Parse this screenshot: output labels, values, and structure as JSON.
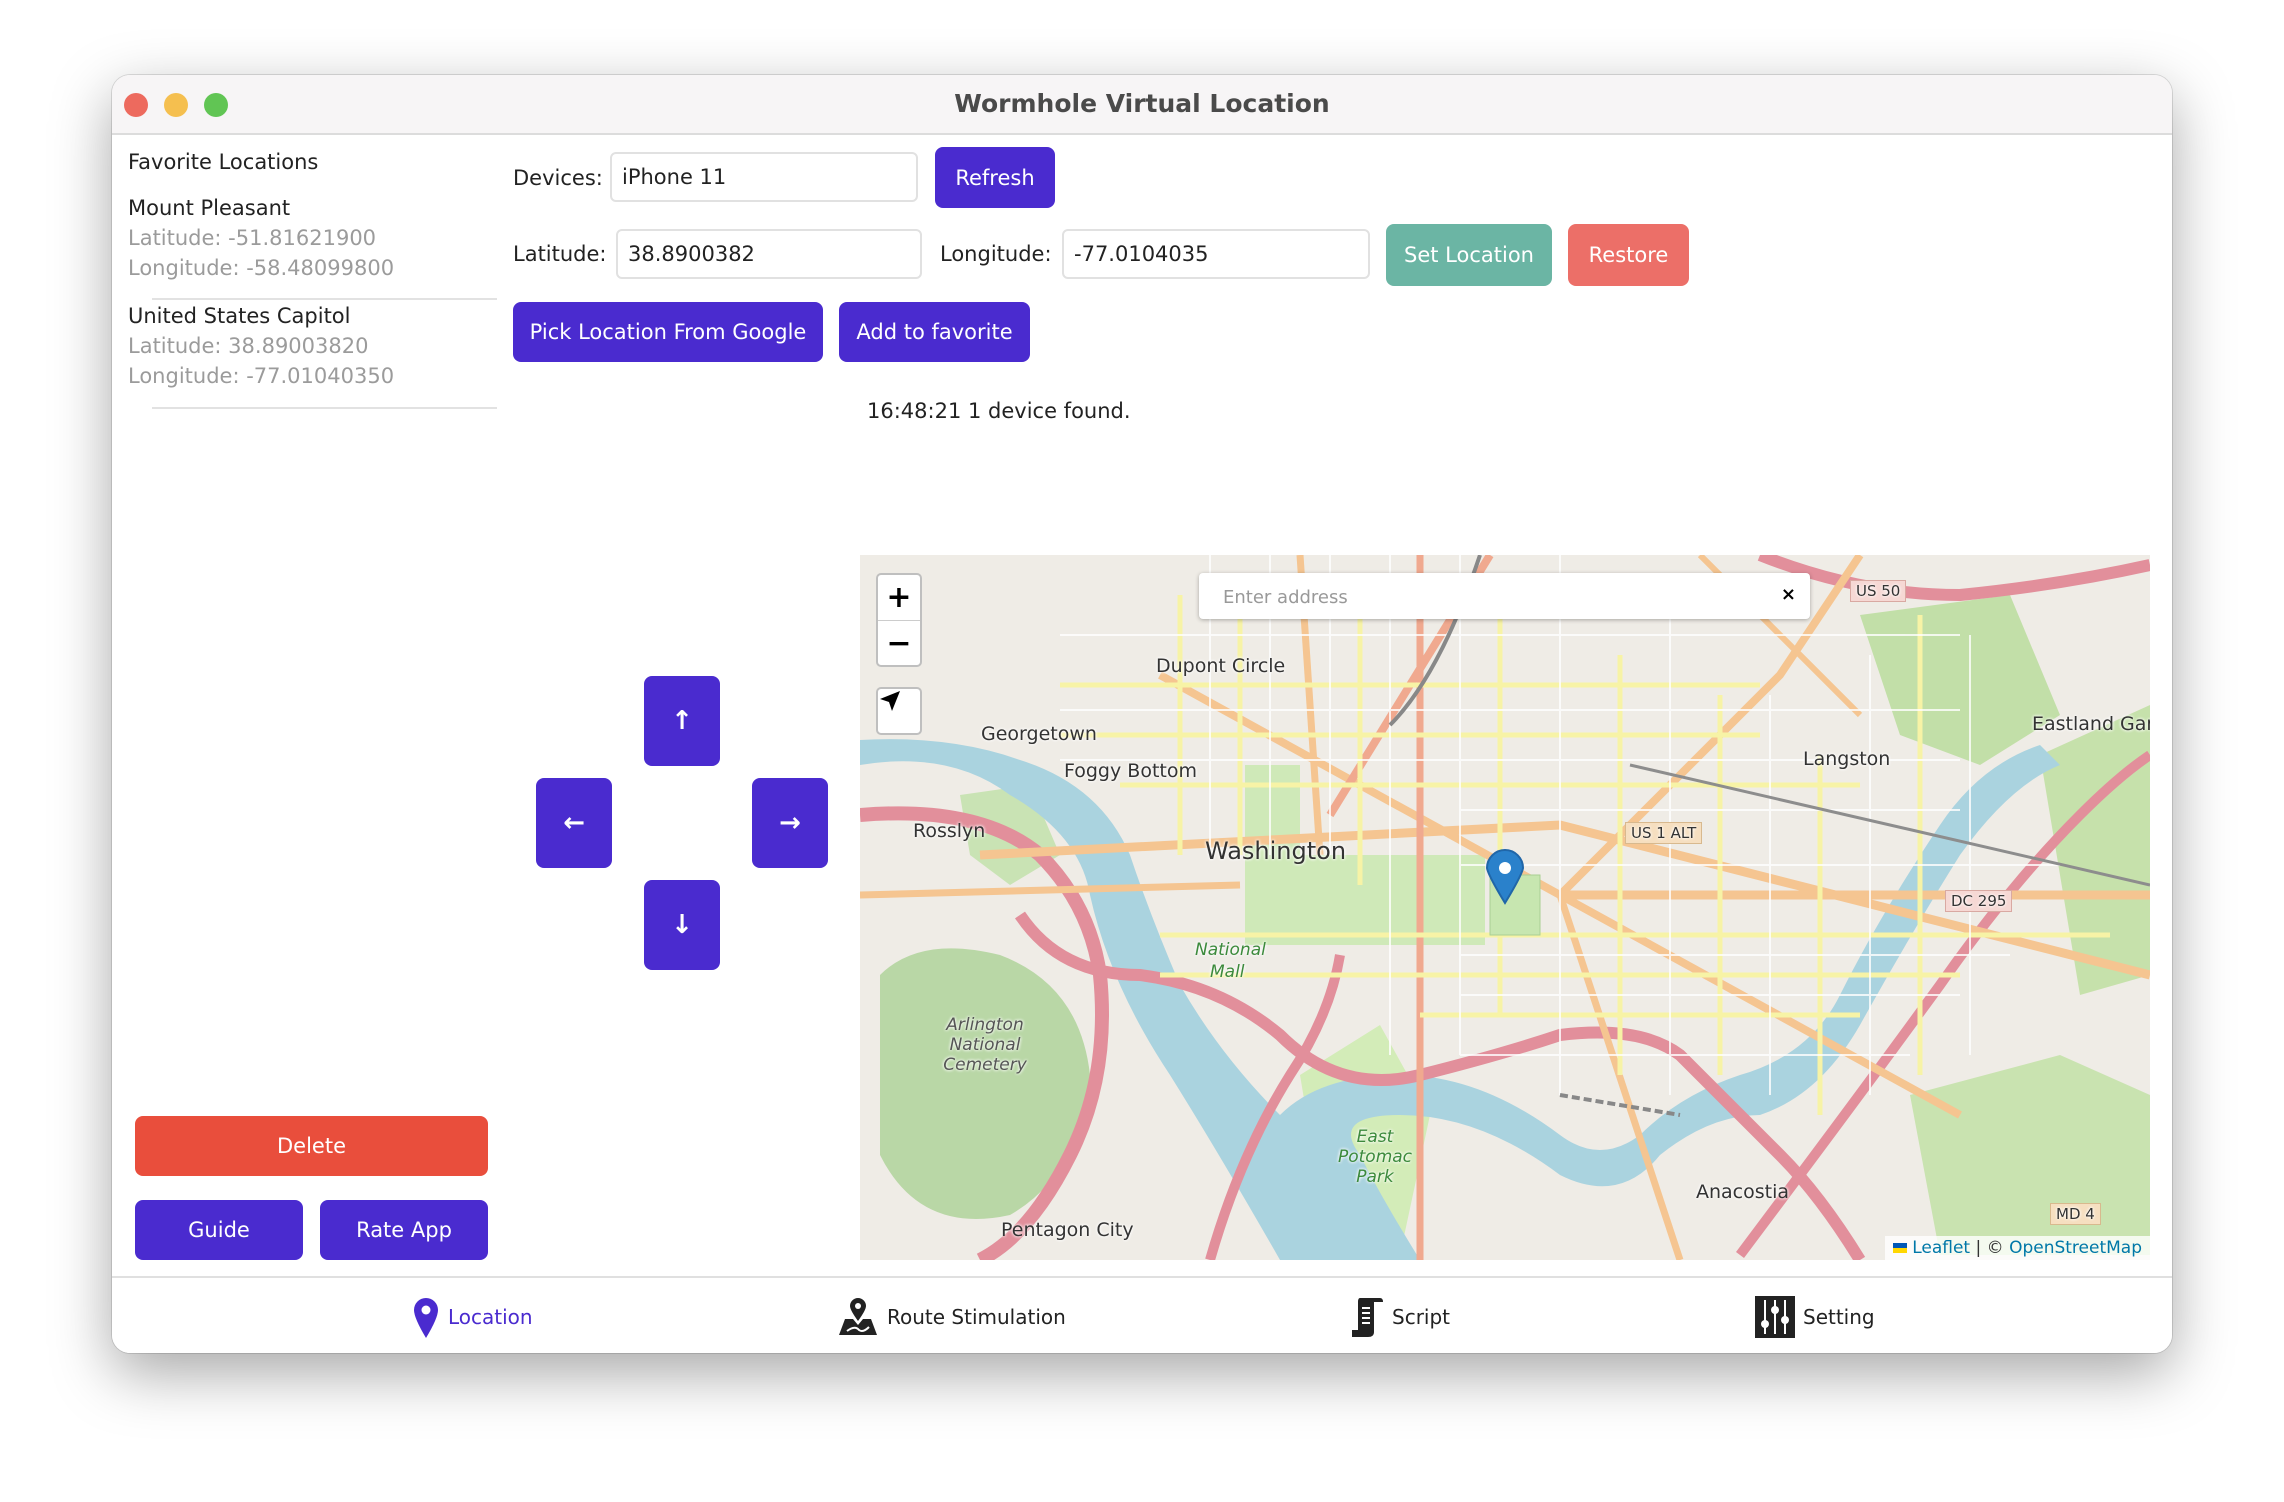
{
  "window": {
    "title": "Wormhole Virtual Location"
  },
  "colors": {
    "primary": "#4a2bcf",
    "delete": "#e94e3c",
    "set_location": "#6bb5a4",
    "restore": "#ec6f68",
    "close": "#ed6a5e",
    "minimize": "#f5bf4f",
    "maximize": "#61c554"
  },
  "sidebar": {
    "heading": "Favorite Locations",
    "favorites": [
      {
        "name": "Mount Pleasant",
        "latitude": "Latitude: -51.81621900",
        "longitude": "Longitude: -58.48099800"
      },
      {
        "name": "United States Capitol",
        "latitude": "Latitude: 38.89003820",
        "longitude": "Longitude: -77.01040350"
      }
    ],
    "delete_label": "Delete",
    "guide_label": "Guide",
    "rate_label": "Rate App"
  },
  "controls": {
    "devices_label": "Devices:",
    "device_value": "iPhone 11",
    "refresh_label": "Refresh",
    "latitude_label": "Latitude:",
    "latitude_value": "38.8900382",
    "longitude_label": "Longitude:",
    "longitude_value": "-77.0104035",
    "set_location_label": "Set Location",
    "restore_label": "Restore",
    "pick_google_label": "Pick Location From Google",
    "add_favorite_label": "Add to favorite",
    "status": "16:48:21 1 device found."
  },
  "dpad": {
    "up": "↑",
    "left": "←",
    "right": "→",
    "down": "↓"
  },
  "map": {
    "zoom_in": "+",
    "zoom_out": "−",
    "search_placeholder": "Enter address",
    "search_clear": "×",
    "attribution_leaflet": "Leaflet",
    "attribution_sep": " | © ",
    "attribution_osm": "OpenStreetMap",
    "labels": {
      "washington": "Washington",
      "dupont": "Dupont Circle",
      "georgetown": "Georgetown",
      "foggy": "Foggy Bottom",
      "rosslyn": "Rosslyn",
      "national_mall_1": "National",
      "national_mall_2": "Mall",
      "langston": "Langston",
      "eastland": "Eastland Garc",
      "anacostia": "Anacostia",
      "pentagon": "Pentagon City",
      "arlington": "Arlington National Cemetery",
      "east_potomac": "East Potomac Park",
      "us50": "US 50",
      "us1alt": "US 1 ALT",
      "dc295": "DC 295",
      "md4": "MD 4"
    }
  },
  "tabs": [
    {
      "label": "Location",
      "icon": "map-pin-icon",
      "active": true
    },
    {
      "label": "Route Stimulation",
      "icon": "route-map-icon",
      "active": false
    },
    {
      "label": "Script",
      "icon": "script-scroll-icon",
      "active": false
    },
    {
      "label": "Setting",
      "icon": "sliders-icon",
      "active": false
    }
  ]
}
